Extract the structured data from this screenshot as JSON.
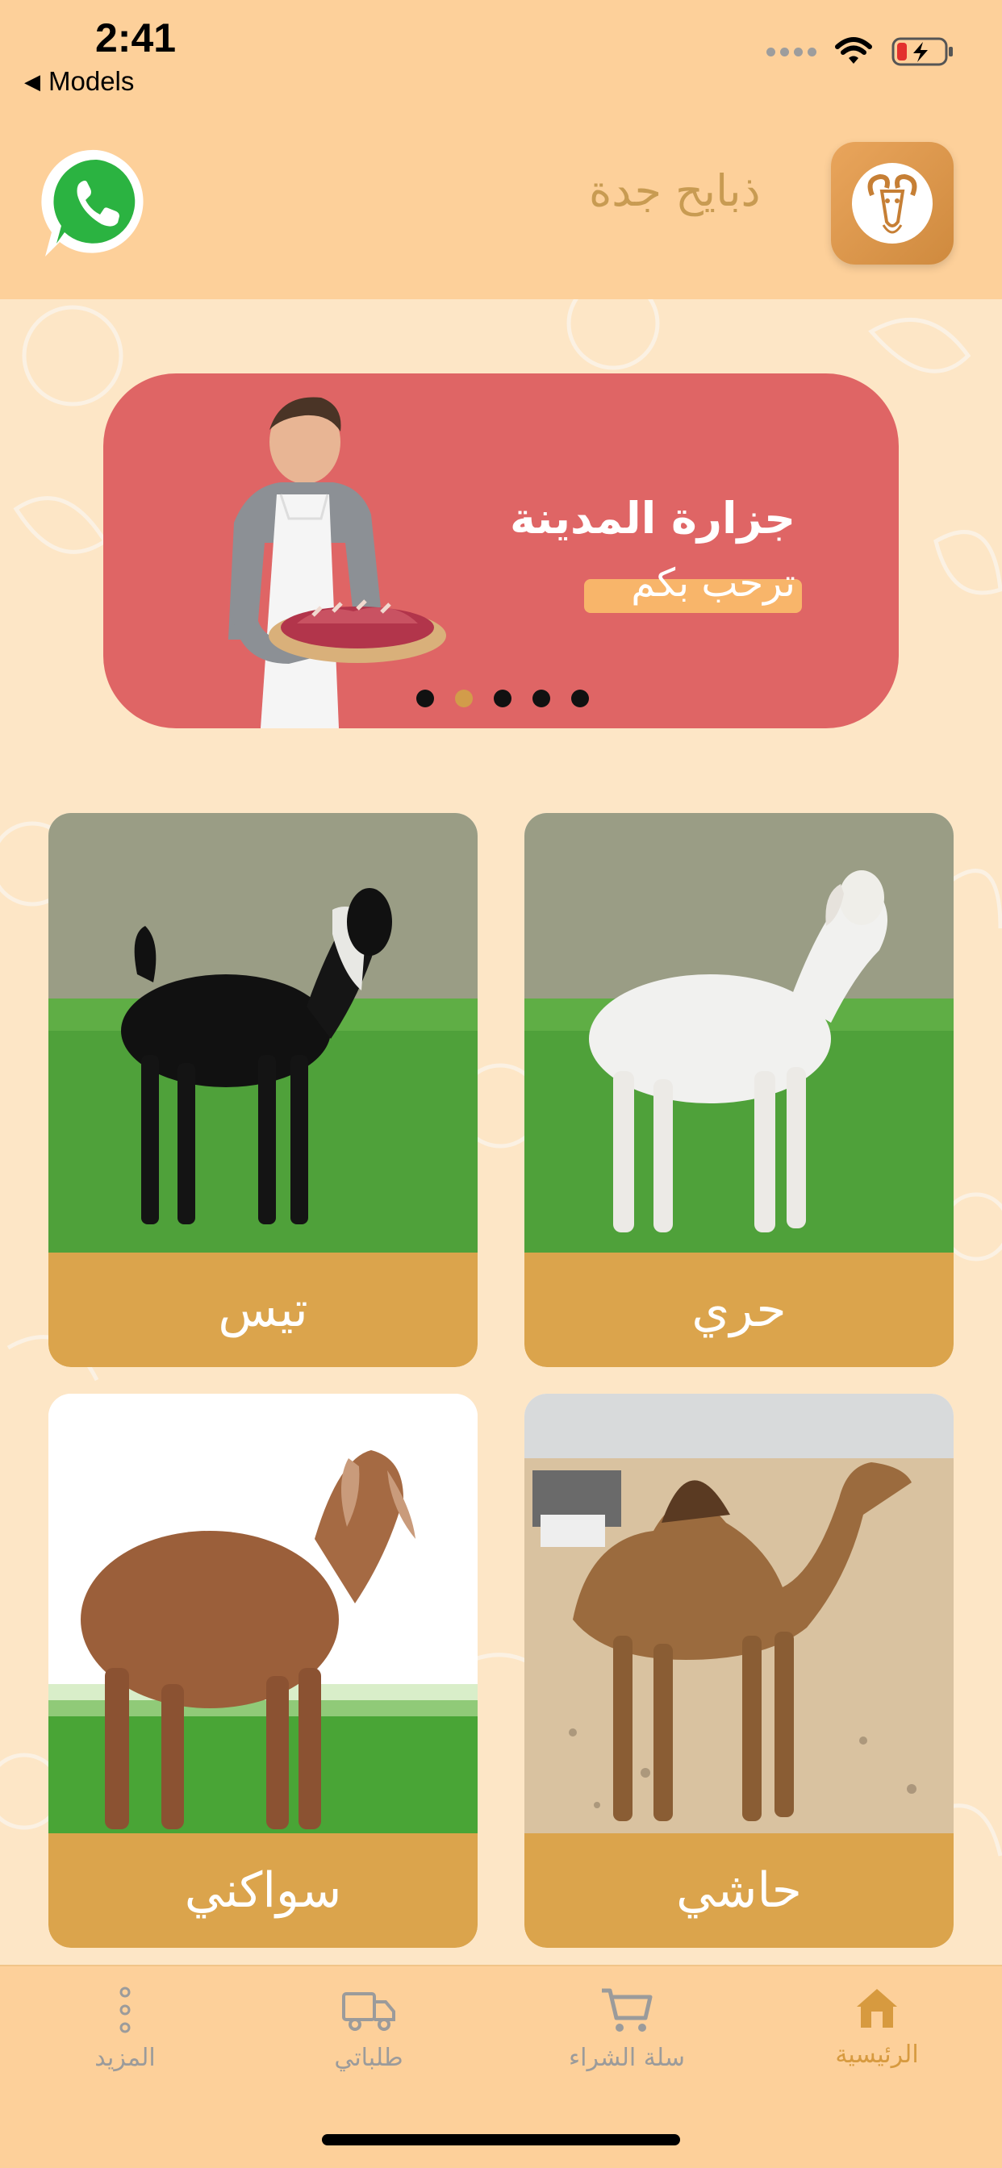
{
  "status_bar": {
    "time": "2:41",
    "back_label": "Models"
  },
  "header": {
    "title": "ذبايح جدة"
  },
  "banner": {
    "title": "جزارة المدينة",
    "subtitle": "ترحب بكم",
    "slides": 5,
    "active_slide": 2
  },
  "categories": [
    {
      "name": "حري",
      "animal": "white-sheep"
    },
    {
      "name": "تيس",
      "animal": "black-goat"
    },
    {
      "name": "حاشي",
      "animal": "camel"
    },
    {
      "name": "سواكني",
      "animal": "brown-sheep"
    }
  ],
  "tabs": [
    {
      "label": "الرئيسية",
      "icon": "home-icon",
      "active": true
    },
    {
      "label": "سلة الشراء",
      "icon": "cart-icon",
      "active": false
    },
    {
      "label": "طلباتي",
      "icon": "truck-icon",
      "active": false
    },
    {
      "label": "المزيد",
      "icon": "more-icon",
      "active": false
    }
  ],
  "colors": {
    "header_bg": "#fdd09a",
    "page_bg": "#fde6c6",
    "banner_bg": "#df6565",
    "card_label_bg": "#dba44c",
    "accent": "#d79a3f",
    "whatsapp": "#25d366"
  }
}
